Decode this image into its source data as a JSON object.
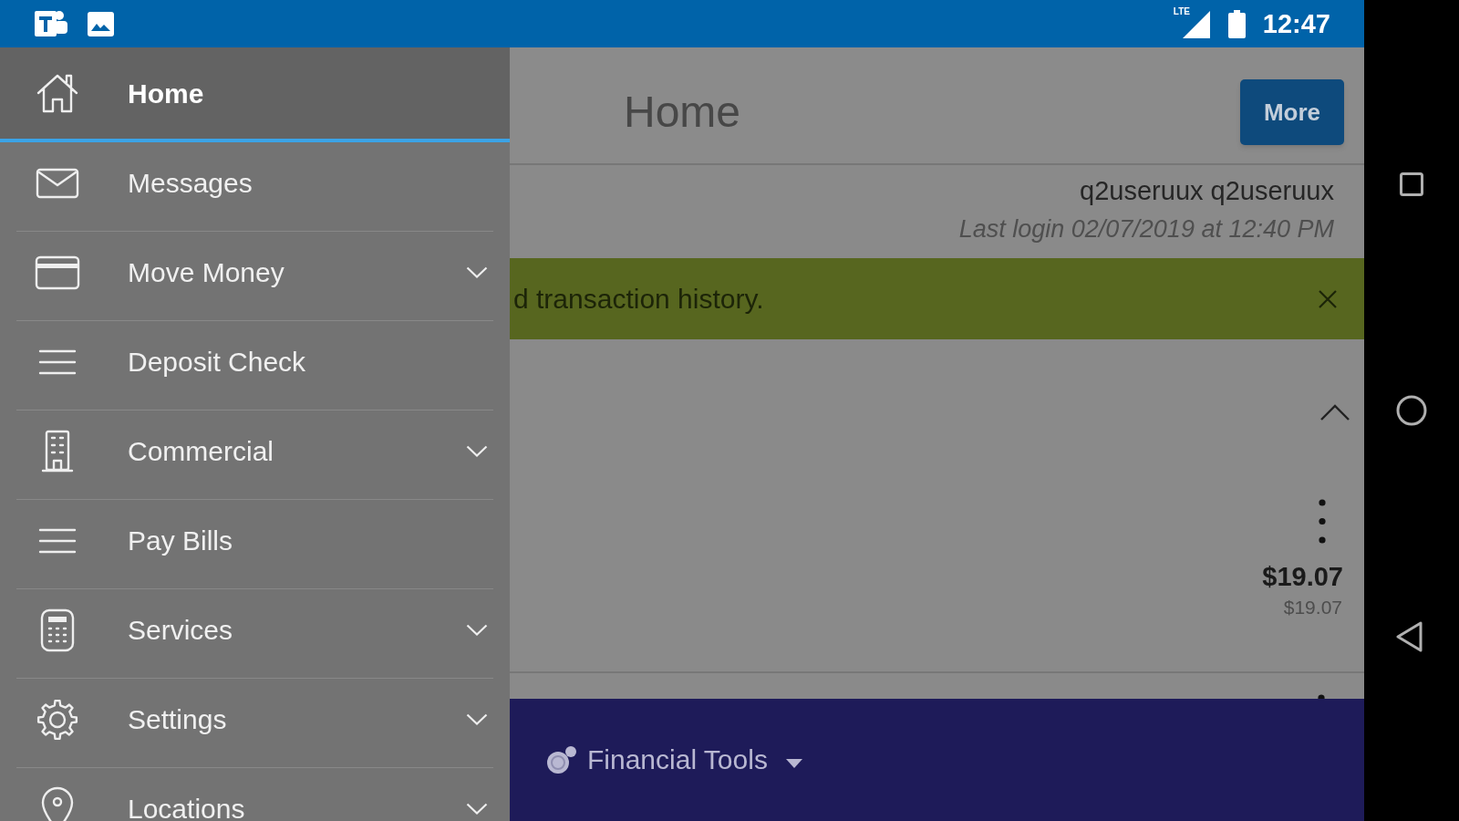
{
  "status_bar": {
    "network": "LTE",
    "time": "12:47"
  },
  "sidebar": {
    "items": [
      {
        "label": "Home",
        "selected": true,
        "expandable": false
      },
      {
        "label": "Messages",
        "selected": false,
        "expandable": false
      },
      {
        "label": "Move Money",
        "selected": false,
        "expandable": true
      },
      {
        "label": "Deposit Check",
        "selected": false,
        "expandable": false
      },
      {
        "label": "Commercial",
        "selected": false,
        "expandable": true
      },
      {
        "label": "Pay Bills",
        "selected": false,
        "expandable": false
      },
      {
        "label": "Services",
        "selected": false,
        "expandable": true
      },
      {
        "label": "Settings",
        "selected": false,
        "expandable": true
      },
      {
        "label": "Locations",
        "selected": false,
        "expandable": true
      }
    ]
  },
  "header": {
    "title": "Home",
    "button": "More"
  },
  "user": {
    "name": "q2useruux q2useruux",
    "last_login": "Last login 02/07/2019 at 12:40 PM"
  },
  "banner": {
    "text": "d transaction history."
  },
  "account": {
    "expanded": true,
    "balance": "$19.07",
    "available_balance": "$19.07"
  },
  "footer": {
    "label": "Financial Tools"
  }
}
